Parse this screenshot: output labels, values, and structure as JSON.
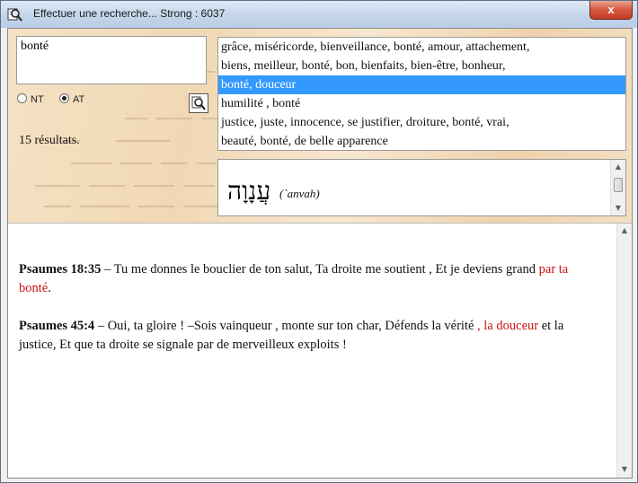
{
  "window": {
    "title": "Effectuer une recherche... Strong : 6037",
    "close_label": "x"
  },
  "search": {
    "query": "bonté",
    "results_count": "15 résultats."
  },
  "testaments": [
    {
      "label": "NT",
      "selected": false
    },
    {
      "label": "AT",
      "selected": true
    }
  ],
  "definitions": [
    "grâce, miséricorde, bienveillance, bonté, amour, attachement,",
    "biens, meilleur, bonté, bon, bienfaits, bien-être, bonheur,",
    "bonté, douceur",
    "humilité , bonté",
    "justice, juste, innocence, se justifier, droiture, bonté, vrai,",
    "beauté, bonté, de belle apparence"
  ],
  "selected_definition_index": 2,
  "hebrew": {
    "word": "עֲנָוָה",
    "transliteration": "(`anvah)"
  },
  "verses": [
    {
      "ref": "Psaumes 18:35",
      "before": " – Tu me donnes le bouclier de ton salut, Ta droite me soutient , Et je deviens grand ",
      "highlight": "par ta bonté",
      "after": "."
    },
    {
      "ref": "Psaumes 45:4",
      "before": " – Oui, ta gloire ! –Sois vainqueur , monte sur ton char, Défends la vérité ",
      "highlight": ", la douceur",
      "after": " et la justice, Et que ta droite se signale par de merveilleux exploits !"
    }
  ],
  "colors": {
    "selection": "#3399ff",
    "highlight": "#cc1111",
    "close_button": "#c23a22"
  },
  "icons": {
    "app": "magnifier-book-icon",
    "search_button": "magnifier-icon"
  }
}
